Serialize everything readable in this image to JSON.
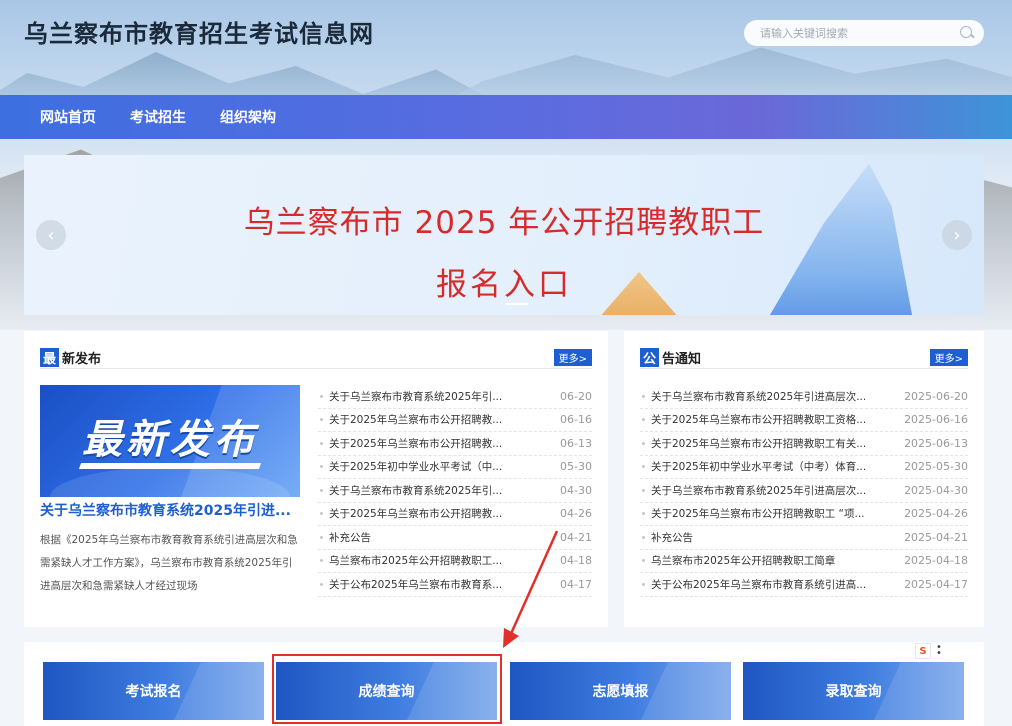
{
  "header": {
    "site_title": "乌兰察布市教育招生考试信息网",
    "search_placeholder": "请输入关键词搜索"
  },
  "nav": {
    "items": [
      "网站首页",
      "考试招生",
      "组织架构"
    ]
  },
  "banner": {
    "line1": "乌兰察布市 2025 年公开招聘教职工",
    "line2": "报名入口",
    "prev_icon": "chevron-left-icon",
    "next_icon": "chevron-right-icon"
  },
  "news": {
    "badge": "最",
    "title": "新发布",
    "more": "更多>",
    "feature_image_text": "最新发布",
    "feature_title": "关于乌兰察布市教育系统2025年引进...",
    "feature_desc": "根据《2025年乌兰察布市教育教育系统引进高层次和急需紧缺人才工作方案》，乌兰察布市教育系统2025年引进高层次和急需紧缺人才经过现场",
    "items": [
      {
        "title": "关于乌兰察布市教育系统2025年引...",
        "date": "06-20"
      },
      {
        "title": "关于2025年乌兰察布市公开招聘教...",
        "date": "06-16"
      },
      {
        "title": "关于2025年乌兰察布市公开招聘教...",
        "date": "06-13"
      },
      {
        "title": "关于2025年初中学业水平考试（中...",
        "date": "05-30"
      },
      {
        "title": "关于乌兰察布市教育系统2025年引...",
        "date": "04-30"
      },
      {
        "title": "关于2025年乌兰察布市公开招聘教...",
        "date": "04-26"
      },
      {
        "title": "补充公告",
        "date": "04-21"
      },
      {
        "title": "乌兰察布市2025年公开招聘教职工...",
        "date": "04-18"
      },
      {
        "title": "关于公布2025年乌兰察布市教育系...",
        "date": "04-17"
      }
    ]
  },
  "notice": {
    "badge": "公",
    "title": "告通知",
    "more": "更多>",
    "items": [
      {
        "title": "关于乌兰察布市教育系统2025年引进高层次...",
        "date": "2025-06-20"
      },
      {
        "title": "关于2025年乌兰察布市公开招聘教职工资格...",
        "date": "2025-06-16"
      },
      {
        "title": "关于2025年乌兰察布市公开招聘教职工有关...",
        "date": "2025-06-13"
      },
      {
        "title": "关于2025年初中学业水平考试（中考）体育...",
        "date": "2025-05-30"
      },
      {
        "title": "关于乌兰察布市教育系统2025年引进高层次...",
        "date": "2025-04-30"
      },
      {
        "title": "关于2025年乌兰察布市公开招聘教职工 “项...",
        "date": "2025-04-26"
      },
      {
        "title": "补充公告",
        "date": "2025-04-21"
      },
      {
        "title": "乌兰察布市2025年公开招聘教职工简章",
        "date": "2025-04-18"
      },
      {
        "title": "关于公布2025年乌兰察布市教育系统引进高...",
        "date": "2025-04-17"
      }
    ]
  },
  "quick_links": [
    "考试报名",
    "成绩查询",
    "志愿填报",
    "录取查询"
  ],
  "colors": {
    "primary": "#1d5fd1",
    "banner_text": "#d62b2b",
    "highlight": "#e0302a"
  }
}
